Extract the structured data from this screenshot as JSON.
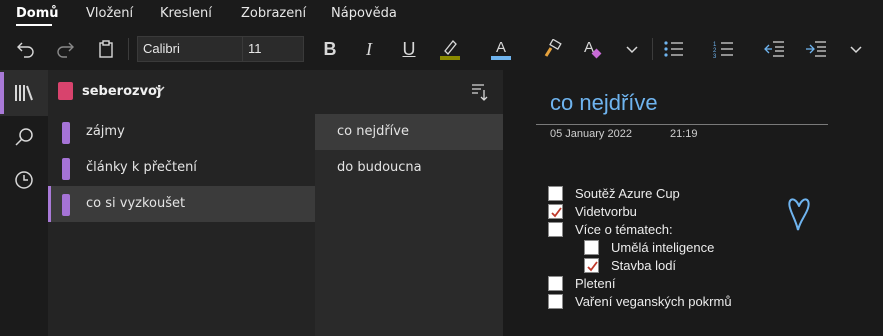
{
  "menu": {
    "tabs": [
      {
        "label": "Domů",
        "active": true
      },
      {
        "label": "Vložení"
      },
      {
        "label": "Kreslení"
      },
      {
        "label": "Zobrazení"
      },
      {
        "label": "Nápověda"
      }
    ]
  },
  "toolbar": {
    "font_family": "Calibri",
    "font_size": "11",
    "highlight_color": "#8a8a00",
    "font_color": "#6fb4ef",
    "icons": [
      "undo-icon",
      "redo-icon",
      "clipboard-icon",
      "bold-icon",
      "italic-icon",
      "underline-icon",
      "highlighter-icon",
      "font-color-icon",
      "format-painter-icon",
      "clear-formatting-icon",
      "more-icon",
      "bullets-icon",
      "numbering-icon",
      "outdent-icon",
      "indent-icon",
      "more-icon"
    ]
  },
  "nav": {
    "icons": [
      "notebooks-icon",
      "search-icon",
      "recent-icon"
    ],
    "accent": "#a97ad8"
  },
  "notebook": {
    "name": "seberozvoj",
    "color": "#d8436d",
    "sections": [
      {
        "label": "zájmy"
      },
      {
        "label": "články k přečtení"
      },
      {
        "label": "co si vyzkoušet",
        "selected": true
      }
    ],
    "section_color": "#a573d6"
  },
  "pages": {
    "items": [
      {
        "label": "co nejdříve",
        "selected": true
      },
      {
        "label": "do budoucna"
      }
    ]
  },
  "page": {
    "title": "co nejdříve",
    "date": "05 January 2022",
    "time": "21:19",
    "title_color": "#6fb4ef",
    "todos": [
      {
        "label": "Soutěž Azure Cup",
        "checked": false,
        "indent": 0
      },
      {
        "label": "Videtvorbu",
        "checked": true,
        "indent": 0
      },
      {
        "label": "Více o tématech:",
        "checked": false,
        "indent": 0
      },
      {
        "label": "Umělá inteligence",
        "checked": false,
        "indent": 1
      },
      {
        "label": "Stavba lodí",
        "checked": true,
        "indent": 1
      },
      {
        "label": "Pletení",
        "checked": false,
        "indent": 0
      },
      {
        "label": "Vaření veganských pokrmů",
        "checked": false,
        "indent": 0
      }
    ],
    "ink_color": "#6fb4ef"
  }
}
